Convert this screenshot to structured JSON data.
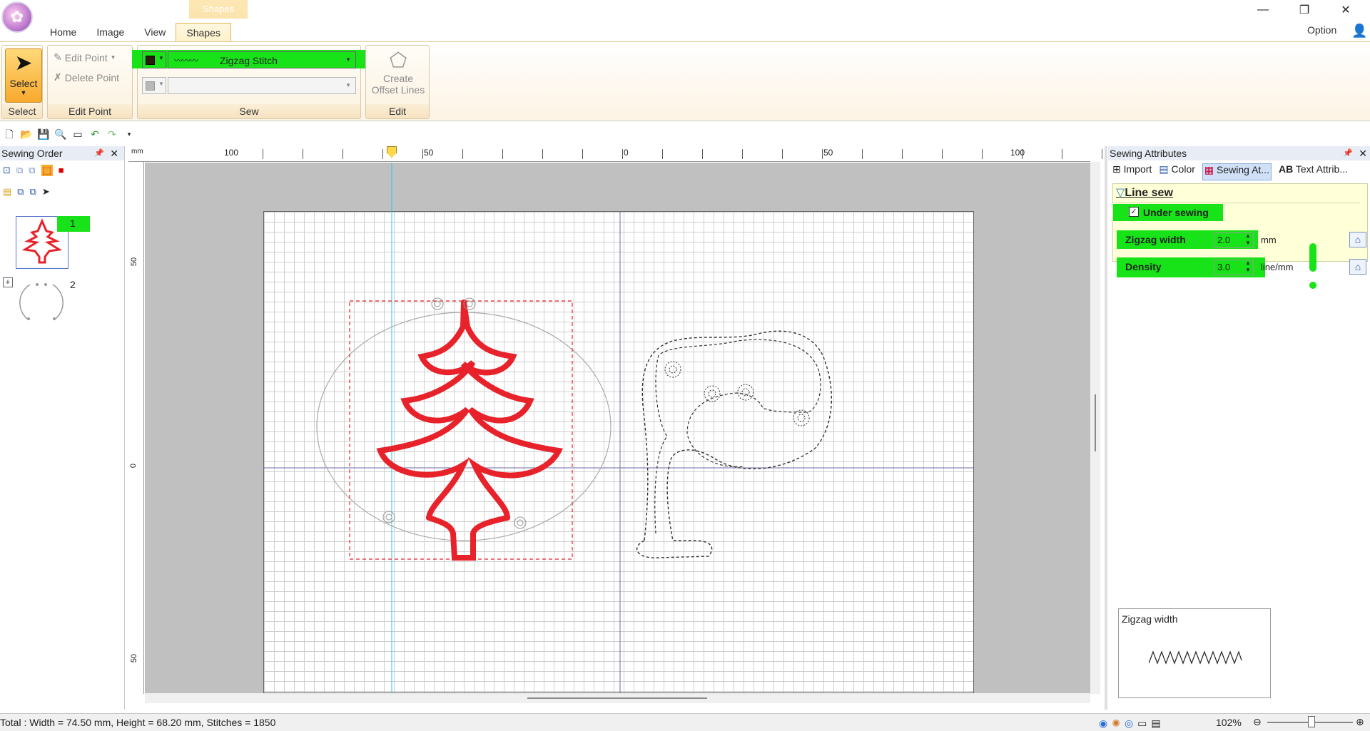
{
  "ribbon_tabs": {
    "contextual": "Shapes",
    "home": "Home",
    "image": "Image",
    "view": "View",
    "shapes": "Shapes"
  },
  "window": {
    "option": "Option",
    "minimize": "—",
    "restore": "❐",
    "close": "✕"
  },
  "ribbon": {
    "select_group": {
      "button": "Select",
      "label": "Select"
    },
    "edit_point_group": {
      "edit_point": "Edit Point",
      "delete_point": "Delete Point",
      "label": "Edit Point"
    },
    "sew_group": {
      "stitch_type": "Zigzag Stitch",
      "label": "Sew"
    },
    "edit_group": {
      "create_offset_line1": "Create",
      "create_offset_line2": "Offset Lines",
      "label": "Edit"
    }
  },
  "sewing_order": {
    "title": "Sewing Order",
    "items": [
      {
        "number": "1"
      },
      {
        "number": "2"
      }
    ]
  },
  "rulers": {
    "unit": "mm",
    "top_ticks": [
      "100",
      "50",
      "0",
      "50",
      "100"
    ],
    "left_ticks": [
      "50",
      "0",
      "50"
    ]
  },
  "sewing_attributes": {
    "title": "Sewing Attributes",
    "tabs": [
      "Import",
      "Color",
      "Sewing At...",
      "Text Attrib..."
    ],
    "section": "Line sew",
    "under_sewing": "Under sewing",
    "zigzag_width_label": "Zigzag width",
    "zigzag_width_value": "2.0",
    "zigzag_width_unit": "mm",
    "density_label": "Density",
    "density_value": "3.0",
    "density_unit": "line/mm",
    "preview_title": "Zigzag width"
  },
  "status": {
    "text": "Total : Width = 74.50 mm, Height = 68.20 mm, Stitches = 1850",
    "zoom": "102%"
  },
  "colors": {
    "highlight": "#18e318",
    "stitch_red": "#e8222a",
    "accent_orange": "#f7a92e"
  }
}
